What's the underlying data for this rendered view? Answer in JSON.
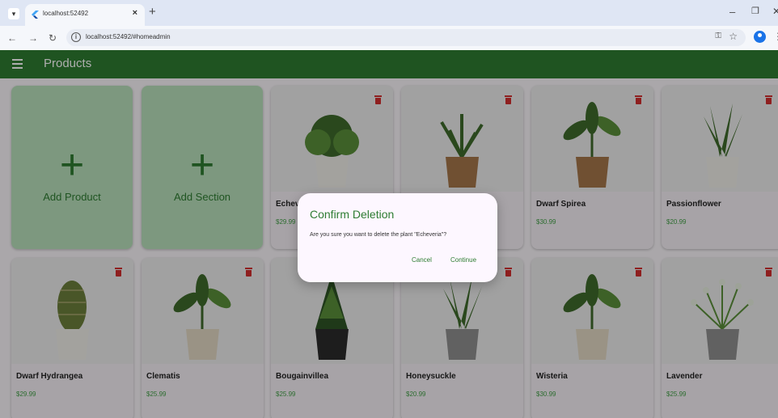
{
  "browser": {
    "tab_title": "localhost:52492",
    "url": "localhost:52492/#homeadmin"
  },
  "app": {
    "title": "Products",
    "colors": {
      "primary": "#2e7d32",
      "add_card": "#b9e0bc",
      "price": "#43a047",
      "delete": "#d32f2f"
    }
  },
  "add_cards": [
    {
      "label": "Add Product"
    },
    {
      "label": "Add Section"
    }
  ],
  "products": [
    {
      "name": "Echeveria",
      "price": "$29.99",
      "pot": "white",
      "plant": "bush"
    },
    {
      "name": "",
      "price": "",
      "pot": "wood",
      "plant": "fern"
    },
    {
      "name": "Dwarf Spirea",
      "price": "$30.99",
      "pot": "wood",
      "plant": "leaves"
    },
    {
      "name": "Passionflower",
      "price": "$20.99",
      "pot": "white",
      "plant": "spiky"
    },
    {
      "name": "Dwarf Hydrangea",
      "price": "$29.99",
      "pot": "white",
      "plant": "cactus"
    },
    {
      "name": "Clematis",
      "price": "$25.99",
      "pot": "beige",
      "plant": "leaves"
    },
    {
      "name": "Bougainvillea",
      "price": "$25.99",
      "pot": "black",
      "plant": "conifer"
    },
    {
      "name": "Honeysuckle",
      "price": "$20.99",
      "pot": "grey",
      "plant": "spiky"
    },
    {
      "name": "Wisteria",
      "price": "$30.99",
      "pot": "beige",
      "plant": "leaves"
    },
    {
      "name": "Lavender",
      "price": "$25.99",
      "pot": "grey",
      "plant": "sprigs"
    }
  ],
  "dialog": {
    "title": "Confirm Deletion",
    "message": "Are you sure you want to delete the plant \"Echeveria\"?",
    "cancel": "Cancel",
    "continue": "Continue"
  }
}
